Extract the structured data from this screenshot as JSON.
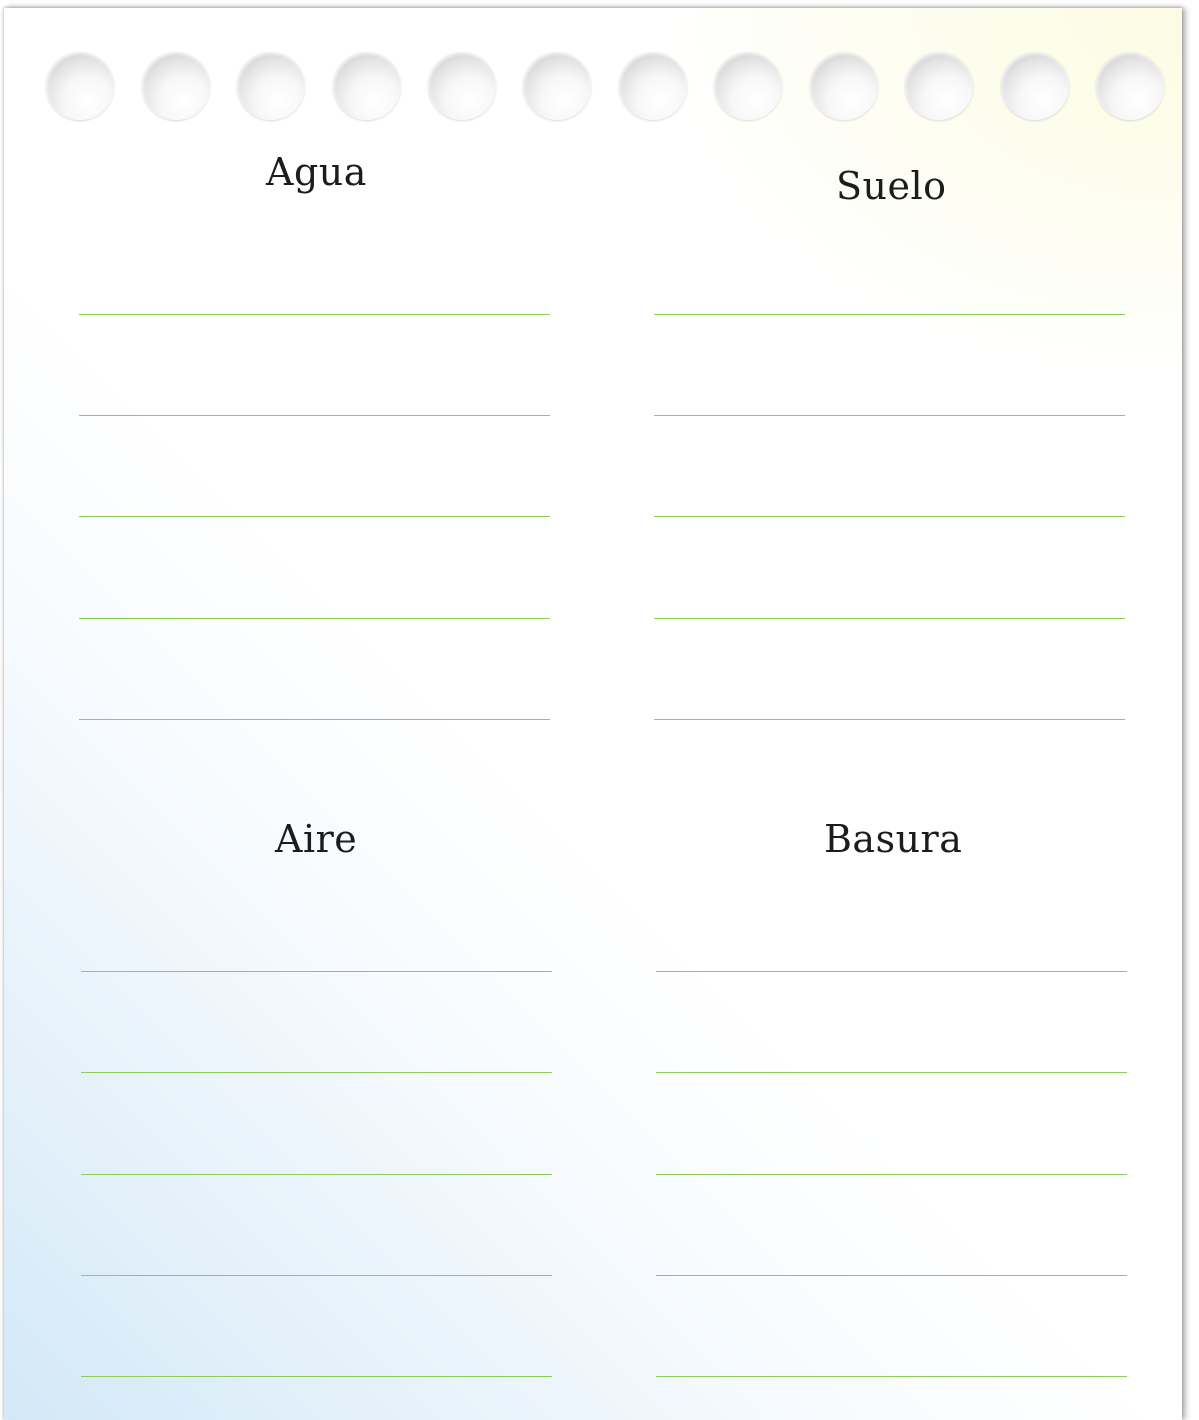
{
  "worksheet": {
    "sections": [
      {
        "title": "Agua"
      },
      {
        "title": "Suelo"
      },
      {
        "title": "Aire"
      },
      {
        "title": "Basura"
      }
    ],
    "lines_per_section": 5,
    "ring_holes": 12
  },
  "colors": {
    "rule_line": "#8ccc5a",
    "title_text": "#1c1c1c",
    "gradient_blue": "#d3e8f7",
    "gradient_yellow": "#fcfce2"
  }
}
